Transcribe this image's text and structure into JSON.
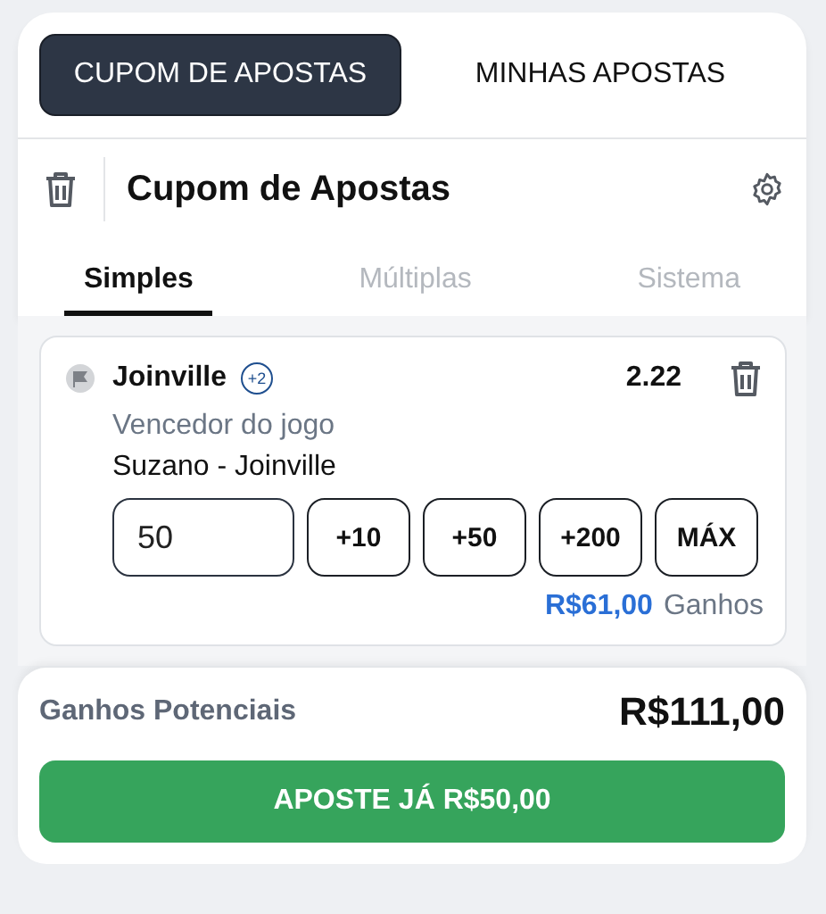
{
  "top_tabs": [
    {
      "label": "CUPOM DE APOSTAS",
      "selected": true
    },
    {
      "label": "MINHAS APOSTAS",
      "selected": false
    }
  ],
  "header": {
    "title": "Cupom de Apostas"
  },
  "bet_tabs": [
    {
      "label": "Simples",
      "selected": true
    },
    {
      "label": "Múltiplas",
      "selected": false
    },
    {
      "label": "Sistema",
      "selected": false
    }
  ],
  "bet": {
    "team": "Joinville",
    "badge": "+2",
    "odds": "2.22",
    "market": "Vencedor do jogo",
    "match": "Suzano - Joinville",
    "stake": "50",
    "quick_amounts": [
      "+10",
      "+50",
      "+200",
      "MÁX"
    ],
    "winnings": "R$61,00",
    "winnings_label": "Ganhos"
  },
  "footer": {
    "label": "Ganhos Potenciais",
    "amount": "R$111,00",
    "button": "APOSTE JÁ R$50,00"
  }
}
